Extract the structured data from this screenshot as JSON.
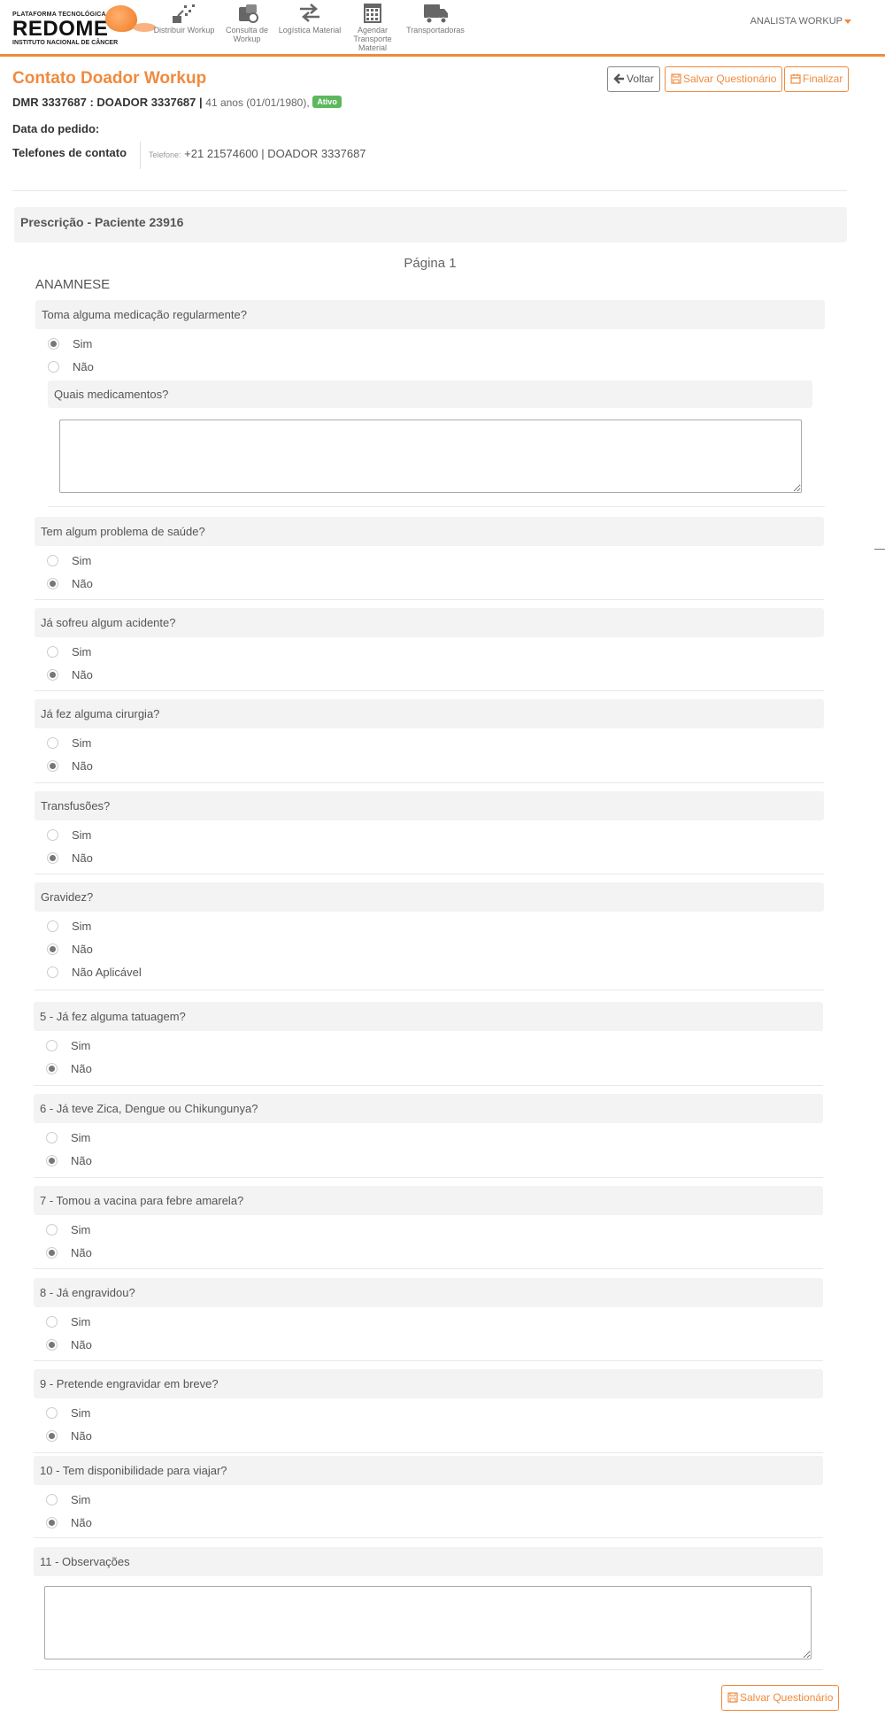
{
  "header": {
    "logo": {
      "line1": "PLATAFORMA TECNOLÓGICA",
      "name": "REDOME",
      "line2": "INSTITUTO NACIONAL DE CÂNCER"
    },
    "nav": [
      {
        "label": "Distribuir Workup",
        "icon": "distribute-icon"
      },
      {
        "label": "Consulta de Workup",
        "icon": "workup-lookup-icon"
      },
      {
        "label": "Logística Material",
        "icon": "arrows-left-right-icon"
      },
      {
        "label": "Agendar Transporte Material",
        "icon": "calendar-icon"
      },
      {
        "label": "Transportadoras",
        "icon": "truck-icon"
      }
    ],
    "user": "ANALISTA WORKUP"
  },
  "page": {
    "title": "Contato Doador Workup",
    "donor_id": "DMR 3337687 : DOADOR 3337687 |",
    "age": "41 anos (01/01/1980),",
    "status": "Ativo",
    "request_date_label": "Data do pedido:",
    "phones_label": "Telefones de contato",
    "phone_prefix": "Telefone:",
    "phone_value": "+21 21574600 | DOADOR 3337687",
    "buttons": {
      "back": "Voltar",
      "save": "Salvar Questionário",
      "finish": "Finalizar"
    },
    "colors": {
      "accent": "#f08a3e",
      "badge": "#5cb85c"
    }
  },
  "form": {
    "section": "Prescrição - Paciente 23916",
    "page": "Página 1",
    "group": "ANAMNESE",
    "sub_question": "Quais medicamentos?",
    "questions": [
      {
        "q": "Toma alguma medicação regularmente?",
        "options": [
          "Sim",
          "Não"
        ],
        "selected": "Sim"
      },
      {
        "q": "Tem algum problema de saúde?",
        "options": [
          "Sim",
          "Não"
        ],
        "selected": "Não"
      },
      {
        "q": "Já sofreu algum acidente?",
        "options": [
          "Sim",
          "Não"
        ],
        "selected": "Não"
      },
      {
        "q": "Já fez alguma cirurgia?",
        "options": [
          "Sim",
          "Não"
        ],
        "selected": "Não"
      },
      {
        "q": "Transfusões?",
        "options": [
          "Sim",
          "Não"
        ],
        "selected": "Não"
      },
      {
        "q": "Gravidez?",
        "options": [
          "Sim",
          "Não",
          "Não Aplicável"
        ],
        "selected": "Não"
      },
      {
        "q": "5 - Já fez alguma tatuagem?",
        "options": [
          "Sim",
          "Não"
        ],
        "selected": "Não"
      },
      {
        "q": "6 - Já teve Zica, Dengue ou Chikungunya?",
        "options": [
          "Sim",
          "Não"
        ],
        "selected": "Não"
      },
      {
        "q": "7 - Tomou a vacina para febre amarela?",
        "options": [
          "Sim",
          "Não"
        ],
        "selected": "Não"
      },
      {
        "q": "8 - Já engravidou?",
        "options": [
          "Sim",
          "Não"
        ],
        "selected": "Não"
      },
      {
        "q": "9 - Pretende engravidar em breve?",
        "options": [
          "Sim",
          "Não"
        ],
        "selected": "Não"
      },
      {
        "q": "10 - Tem disponibilidade para viajar?",
        "options": [
          "Sim",
          "Não"
        ],
        "selected": "Não"
      }
    ],
    "observations_label": "11 - Observações",
    "save_bottom": "Salvar Questionário"
  }
}
